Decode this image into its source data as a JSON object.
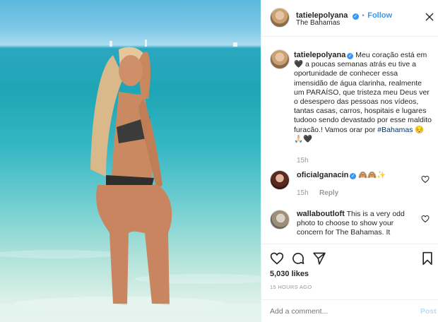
{
  "post": {
    "username": "tatielepolyana",
    "follow_label": "Follow",
    "separator": "•",
    "location": "The Bahamas",
    "more_icon": "more-horizontal-icon"
  },
  "caption": {
    "username": "tatielepolyana",
    "text_1": " Meu coração está em ",
    "heart_emoji": "🖤",
    "text_2": " a poucas semanas atrás eu tive a oportunidade de conhecer essa imensidão de água clarinha, realmente um PARAÍSO, que tristeza meu Deus ver o desespero das pessoas nos vídeos, tantas casas, carros, hospitais e lugares tudooo sendo devastado por esse maldito furacão.! Vamos orar por ",
    "hashtag": "#Bahamas",
    "emojis": " 😔🙏🏻🖤",
    "time": "15h"
  },
  "comments": [
    {
      "username": "oficialganacin",
      "text": "🙈🙈✨",
      "time": "15h",
      "reply_label": "Reply"
    },
    {
      "username": "wallaboutloft",
      "text": "This is a very odd photo to choose to show your concern for The Bahamas. It"
    }
  ],
  "actions": {
    "likes": "5,030 likes",
    "timestamp": "15 HOURS AGO",
    "comment_placeholder": "Add a comment...",
    "post_label": "Post"
  },
  "colors": {
    "accent": "#3897f0",
    "text": "#262626",
    "muted": "#999999"
  }
}
